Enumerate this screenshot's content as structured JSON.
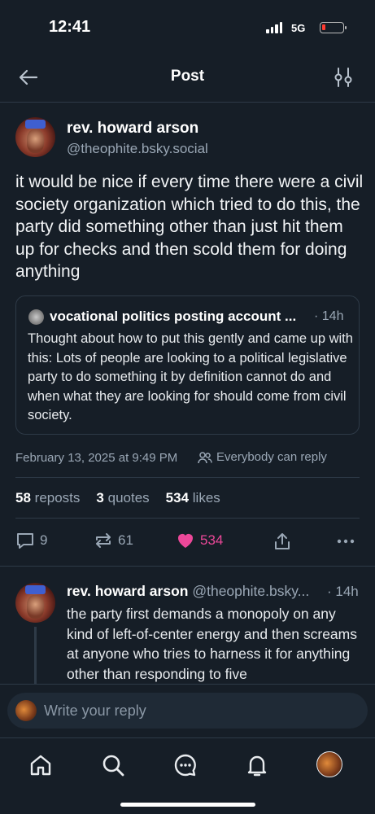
{
  "status_bar": {
    "time": "12:41",
    "network": "5G",
    "battery_color": "#ff3b30"
  },
  "header": {
    "title": "Post",
    "back_icon": "arrow-left-icon",
    "options_icon": "sliders-icon"
  },
  "post": {
    "author_name": "rev. howard arson",
    "author_handle": "@theophite.bsky.social",
    "text": "it would be nice if every time there were a civil society organization which tried to do this, the party did something other than just hit them up for checks and then scold them for doing anything",
    "quote": {
      "author_name": "vocational politics posting account ...",
      "time": "· 14h",
      "text": "Thought about how to put this gently and came up with this: Lots of people are looking to a political legislative party to do something it by definition cannot do and when what they are looking for should come from civil society."
    },
    "date": "February 13, 2025 at 9:49 PM",
    "reply_setting": "Everybody can reply",
    "stats": {
      "reposts_count": "58",
      "reposts_label": "reposts",
      "quotes_count": "3",
      "quotes_label": "quotes",
      "likes_count": "534",
      "likes_label": "likes"
    },
    "actions": {
      "replies": "9",
      "reposts": "61",
      "likes": "534"
    }
  },
  "reply": {
    "author_name": "rev. howard arson",
    "author_handle": "@theophite.bsky...",
    "time": "· 14h",
    "text": "the party first demands a monopoly on any kind of left-of-center energy and then screams at anyone who tries to harness it for anything other than responding to five"
  },
  "composer": {
    "placeholder": "Write your reply"
  },
  "colors": {
    "background": "#161e27",
    "like_accent": "#ec4899",
    "muted": "#9aa7b5"
  },
  "tabbar": {
    "items": [
      "home-icon",
      "search-icon",
      "chat-icon",
      "bell-icon",
      "profile-avatar"
    ]
  }
}
